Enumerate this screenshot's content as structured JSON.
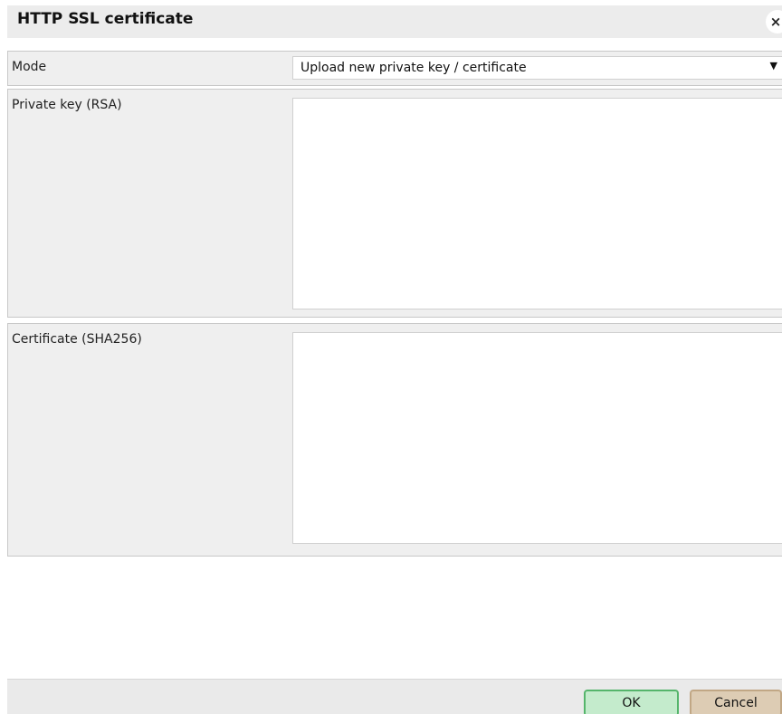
{
  "dialog": {
    "title": "HTTP SSL certificate",
    "close_glyph": "×"
  },
  "form": {
    "mode": {
      "label": "Mode",
      "selected_value": "Upload new private key / certificate",
      "arrow_glyph": "▼"
    },
    "private_key": {
      "label": "Private key (RSA)",
      "value": ""
    },
    "certificate": {
      "label": "Certificate (SHA256)",
      "value": ""
    }
  },
  "footer": {
    "ok_label": "OK",
    "cancel_label": "Cancel"
  },
  "colors": {
    "ok_fill": "#c4ebcc",
    "ok_border": "#55b56b",
    "cancel_fill": "#ddccb4",
    "cancel_border": "#c1a785",
    "row_background": "#efefef",
    "titlebar_background": "#ececec"
  },
  "icons": {
    "close": "close-icon",
    "dropdown": "chevron-down-icon"
  }
}
